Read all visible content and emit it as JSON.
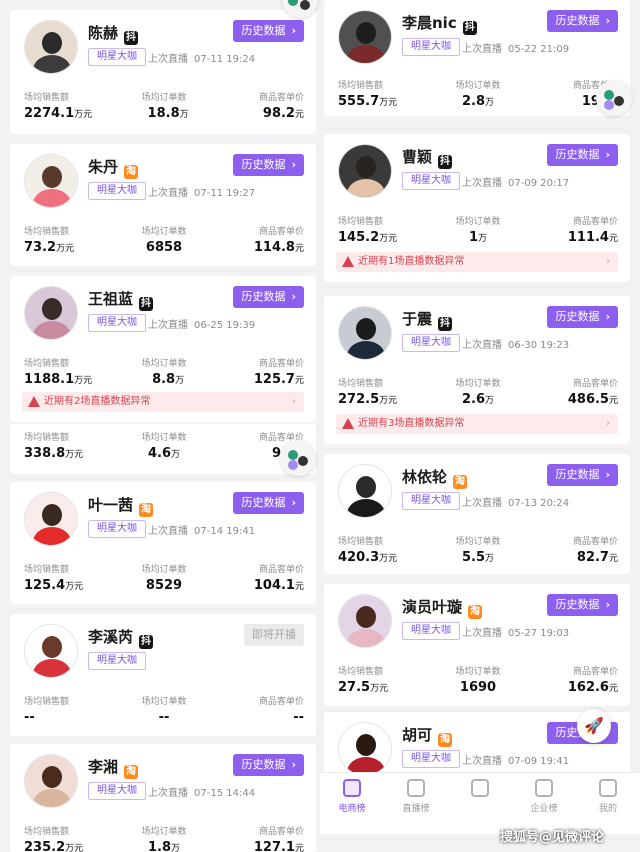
{
  "labels": {
    "hist_btn": "历史数据",
    "badge": "明星大咖",
    "last_live_prefix": "上次直播",
    "col1": "场均销售额",
    "col2": "场均订单数",
    "col3": "商品客单价",
    "unit_wan": "万元",
    "unit_wan_orders": "万",
    "unit_yuan": "元",
    "chevron": "›"
  },
  "left_cards": [
    {
      "name": "陈赫",
      "platform": "douyin",
      "platform_icon": "抖",
      "last_live": "07-11 19:24",
      "sales": "2274.1",
      "orders": "18.8",
      "orders_unit": "万",
      "price": "98.2",
      "warning": "",
      "button": "历史数据",
      "avatar_colors": [
        "#e7dcd0",
        "#2b2b2b",
        "#3c3c3c"
      ]
    },
    {
      "name": "朱丹",
      "platform": "taobao",
      "platform_icon": "淘",
      "last_live": "07-11 19:27",
      "sales": "73.2",
      "orders": "6858",
      "orders_unit": "",
      "price": "114.8",
      "warning": "",
      "button": "历史数据",
      "avatar_colors": [
        "#f3eee8",
        "#5a3a2a",
        "#ef6f7f"
      ]
    },
    {
      "name": "王祖蓝",
      "platform": "douyin",
      "platform_icon": "抖",
      "last_live": "06-25 19:39",
      "sales": "1188.1",
      "orders": "8.8",
      "orders_unit": "万",
      "price": "125.7",
      "warning": "近期有2场直播数据异常",
      "button": "历史数据",
      "avatar_colors": [
        "#d8c8d8",
        "#3a2a2a",
        "#c88aa0"
      ]
    },
    {
      "name": "",
      "platform": "",
      "platform_icon": "",
      "last_live": "",
      "sales": "338.8",
      "orders": "4.6",
      "orders_unit": "万",
      "price": "94.",
      "warning": "",
      "button": "",
      "avatar_colors": []
    },
    {
      "name": "叶一茜",
      "platform": "taobao",
      "platform_icon": "淘",
      "last_live": "07-14 19:41",
      "sales": "125.4",
      "orders": "8529",
      "orders_unit": "",
      "price": "104.1",
      "warning": "",
      "button": "历史数据",
      "avatar_colors": [
        "#fbecec",
        "#3a2a22",
        "#e32b2b"
      ]
    },
    {
      "name": "李溪芮",
      "platform": "douyin",
      "platform_icon": "抖",
      "last_live": "",
      "sales": "--",
      "orders": "--",
      "orders_unit": "",
      "price": "--",
      "warning": "",
      "button": "即将开播",
      "avatar_colors": [
        "#ffffff",
        "#6a3a2a",
        "#d9323a"
      ]
    },
    {
      "name": "李湘",
      "platform": "taobao",
      "platform_icon": "淘",
      "last_live": "07-15 14:44",
      "sales": "235.2",
      "orders": "1.8",
      "orders_unit": "万",
      "price": "127.1",
      "warning": "",
      "button": "历史数据",
      "avatar_colors": [
        "#f1dcd6",
        "#4a2c1e",
        "#d9b59e"
      ]
    }
  ],
  "right_cards": [
    {
      "name": "李晨nic",
      "platform": "douyin",
      "platform_icon": "抖",
      "last_live": "05-22 21:09",
      "sales": "555.7",
      "orders": "2.8",
      "orders_unit": "万",
      "price": "197",
      "warning": "",
      "button": "历史数据",
      "avatar_colors": [
        "#505050",
        "#1e1e1e",
        "#7a2a2a"
      ]
    },
    {
      "name": "曹颖",
      "platform": "douyin",
      "platform_icon": "抖",
      "last_live": "07-09 20:17",
      "sales": "145.2",
      "orders": "1",
      "orders_unit": "万",
      "price": "111.4",
      "warning": "近期有1场直播数据异常",
      "button": "历史数据",
      "avatar_colors": [
        "#3a3a3a",
        "#2a2420",
        "#e4c2a8"
      ]
    },
    {
      "name": "于震",
      "platform": "douyin",
      "platform_icon": "抖",
      "last_live": "06-30 19:23",
      "sales": "272.5",
      "orders": "2.6",
      "orders_unit": "万",
      "price": "486.5",
      "warning": "近期有3场直播数据异常",
      "button": "历史数据",
      "avatar_colors": [
        "#c7ccd3",
        "#1c1c1c",
        "#1e2a3a"
      ]
    },
    {
      "name": "林依轮",
      "platform": "taobao",
      "platform_icon": "淘",
      "last_live": "07-13 20:24",
      "sales": "420.3",
      "orders": "5.5",
      "orders_unit": "万",
      "price": "82.7",
      "warning": "",
      "button": "历史数据",
      "avatar_colors": [
        "#ffffff",
        "#2a2a2a",
        "#1a1a1a"
      ]
    },
    {
      "name": "演员叶璇",
      "platform": "taobao",
      "platform_icon": "淘",
      "last_live": "05-27 19:03",
      "sales": "27.5",
      "orders": "1690",
      "orders_unit": "",
      "price": "162.6",
      "warning": "",
      "button": "历史数据",
      "avatar_colors": [
        "#e3d4e6",
        "#4a2a20",
        "#e7b7c3"
      ]
    },
    {
      "name": "胡可",
      "platform": "taobao",
      "platform_icon": "淘",
      "last_live": "07-09 19:41",
      "sales": "",
      "orders": "",
      "orders_unit": "",
      "price": "",
      "warning": "",
      "button": "历史数据",
      "avatar_colors": [
        "#ffffff",
        "#2a1a12",
        "#b4212d"
      ]
    }
  ],
  "bottom_nav": [
    {
      "label": "电商榜",
      "active": true
    },
    {
      "label": "直播榜",
      "active": false
    },
    {
      "label": "",
      "active": false
    },
    {
      "label": "企业榜",
      "active": false
    },
    {
      "label": "我的",
      "active": false
    }
  ],
  "watermark": "搜狐号@见微评论",
  "colors": {
    "accent": "#8c5fee",
    "warn": "#d6434f",
    "warn_bg": "#fdebec"
  }
}
